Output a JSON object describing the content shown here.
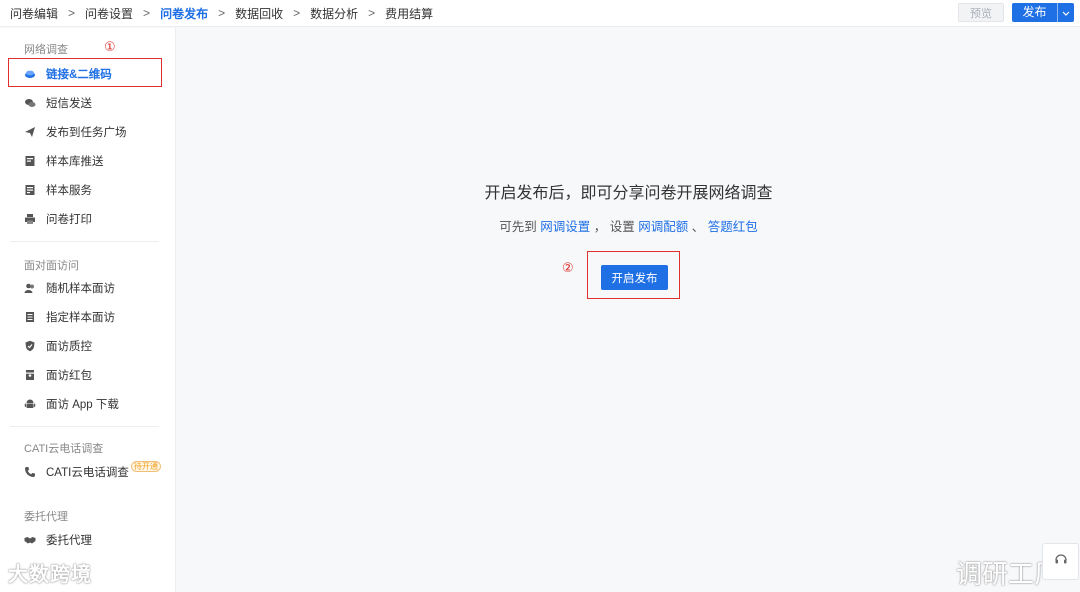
{
  "breadcrumb": [
    {
      "label": "问卷编辑"
    },
    {
      "label": "问卷设置"
    },
    {
      "label": "问卷发布",
      "active": true
    },
    {
      "label": "数据回收"
    },
    {
      "label": "数据分析"
    },
    {
      "label": "费用结算"
    }
  ],
  "separator": ">",
  "top_actions": {
    "preview_label": "预览",
    "publish_label": "发布",
    "dropdown_icon": "chevron-down-icon"
  },
  "sidebar": {
    "groups": [
      {
        "title": "网络调查",
        "items": [
          {
            "label": "链接&二维码",
            "icon": "link-icon",
            "active": true
          },
          {
            "label": "短信发送",
            "icon": "chat-icon"
          },
          {
            "label": "发布到任务广场",
            "icon": "send-icon"
          },
          {
            "label": "样本库推送",
            "icon": "sample-push-icon"
          },
          {
            "label": "样本服务",
            "icon": "sample-service-icon"
          },
          {
            "label": "问卷打印",
            "icon": "print-icon"
          }
        ]
      },
      {
        "title": "面对面访问",
        "items": [
          {
            "label": "随机样本面访",
            "icon": "users-icon"
          },
          {
            "label": "指定样本面访",
            "icon": "document-icon"
          },
          {
            "label": "面访质控",
            "icon": "shield-icon"
          },
          {
            "label": "面访红包",
            "icon": "red-packet-icon"
          },
          {
            "label": "面访 App 下载",
            "icon": "android-icon"
          }
        ]
      },
      {
        "title": "CATI云电话调查",
        "items": [
          {
            "label": "CATI云电话调查",
            "icon": "phone-icon",
            "badge": "待开通"
          }
        ]
      },
      {
        "title": "委托代理",
        "items": [
          {
            "label": "委托代理",
            "icon": "handshake-icon"
          }
        ]
      }
    ]
  },
  "main": {
    "headline": "开启发布后，即可分享问卷开展网络调查",
    "sub_prefix": "可先到",
    "link_1": "网调设置",
    "sub_mid": "， 设置",
    "link_2": "网调配额",
    "sub_sep": "、",
    "link_3": "答题红包",
    "start_button": "开启发布"
  },
  "annotations": {
    "one": "①",
    "two": "②"
  },
  "watermarks": {
    "left": "大数跨境",
    "right": "调研工厂"
  },
  "colors": {
    "accent": "#1f6fe5",
    "highlight_box": "#e0302e"
  }
}
